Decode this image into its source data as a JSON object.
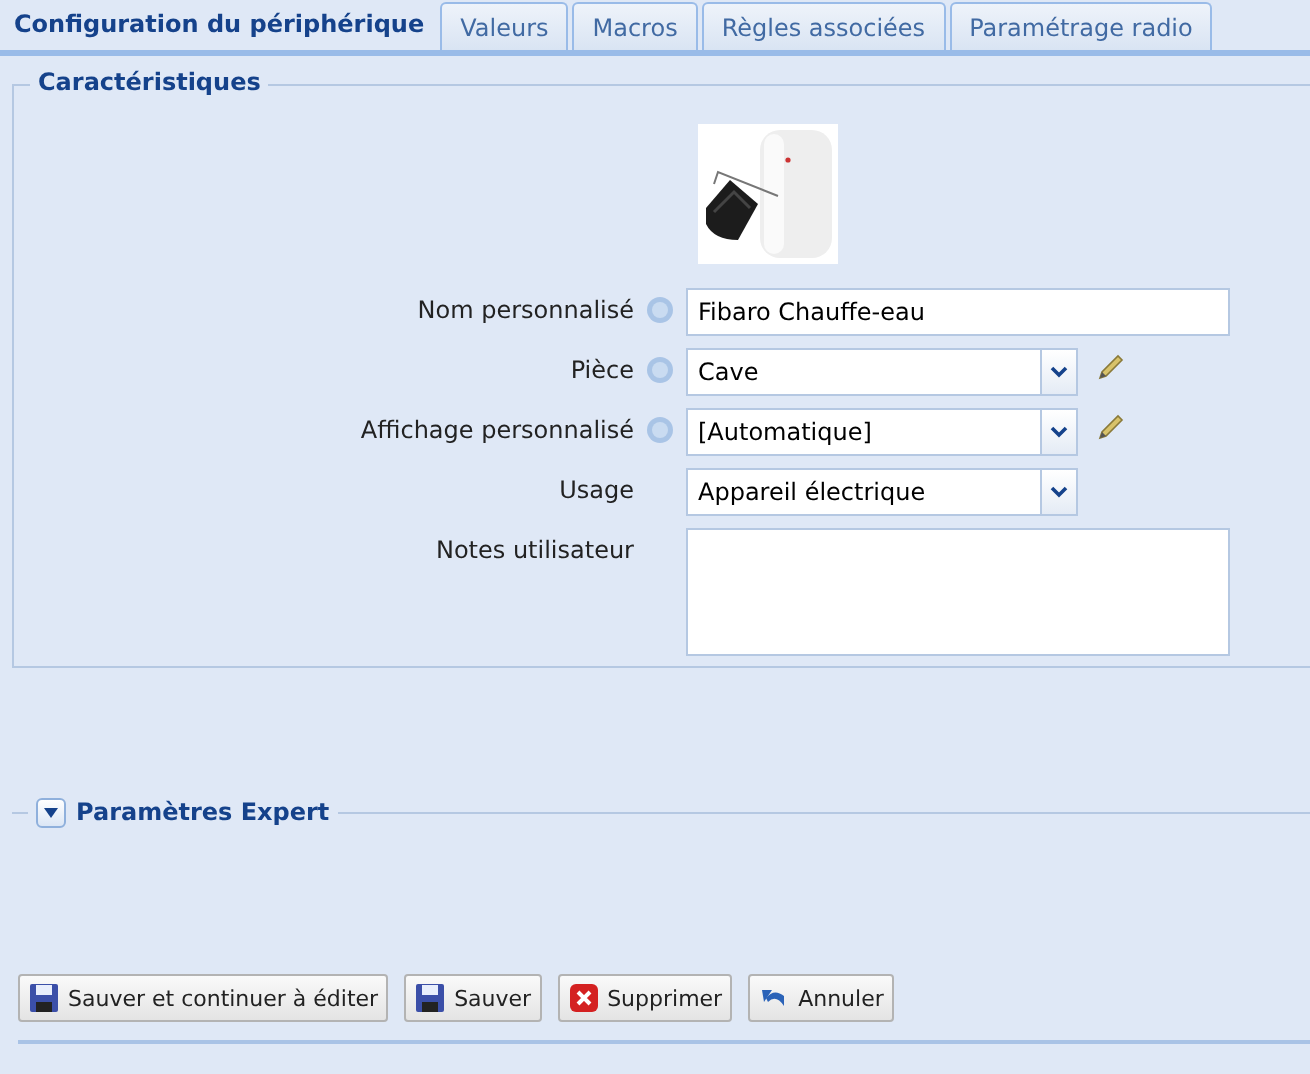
{
  "tabs": [
    {
      "label": "Configuration du périphérique",
      "selected": true
    },
    {
      "label": "Valeurs",
      "selected": false
    },
    {
      "label": "Macros",
      "selected": false
    },
    {
      "label": "Règles associées",
      "selected": false
    },
    {
      "label": "Paramétrage radio",
      "selected": false
    }
  ],
  "characteristics": {
    "title": "Caractéristiques",
    "fields": [
      {
        "kind": "text",
        "label": "Nom personnalisé",
        "help": true,
        "value": "Fibaro Chauffe-eau",
        "editable": false
      },
      {
        "kind": "select",
        "label": "Pièce",
        "help": true,
        "value": "Cave",
        "editable": true
      },
      {
        "kind": "select",
        "label": "Affichage personnalisé",
        "help": true,
        "value": "[Automatique]",
        "editable": true
      },
      {
        "kind": "select",
        "label": "Usage",
        "help": false,
        "value": "Appareil électrique",
        "editable": false
      },
      {
        "kind": "textarea",
        "label": "Notes utilisateur",
        "help": false,
        "editable": false
      }
    ]
  },
  "expert": {
    "title": "Paramètres Expert",
    "expanded": false
  },
  "buttons": [
    {
      "kind": "save",
      "label": "Sauver et continuer à éditer"
    },
    {
      "kind": "save",
      "label": "Sauver"
    },
    {
      "kind": "delete",
      "label": "Supprimer"
    },
    {
      "kind": "cancel",
      "label": "Annuler"
    }
  ]
}
